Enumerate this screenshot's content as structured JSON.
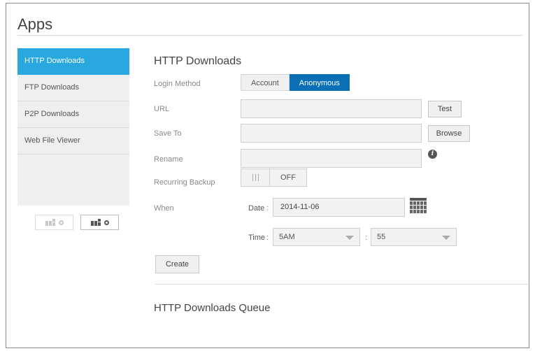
{
  "page": {
    "title": "Apps"
  },
  "sidebar": {
    "items": [
      {
        "label": "HTTP Downloads",
        "active": true
      },
      {
        "label": "FTP Downloads",
        "active": false
      },
      {
        "label": "P2P Downloads",
        "active": false
      },
      {
        "label": "Web File Viewer",
        "active": false
      }
    ],
    "buttons": [
      {
        "icon": "remove-app-icon",
        "enabled": false
      },
      {
        "icon": "add-app-icon",
        "enabled": true
      }
    ]
  },
  "form": {
    "title": "HTTP Downloads",
    "login_method": {
      "label": "Login Method",
      "options": [
        "Account",
        "Anonymous"
      ],
      "selected": "Anonymous"
    },
    "url": {
      "label": "URL",
      "value": "",
      "button": "Test"
    },
    "save_to": {
      "label": "Save To",
      "value": "",
      "button": "Browse"
    },
    "rename": {
      "label": "Rename",
      "value": "",
      "info_icon": "info-icon"
    },
    "recurring_backup": {
      "label": "Recurring Backup",
      "state": "OFF"
    },
    "when": {
      "label": "When",
      "date_label": "Date",
      "date_value": "2014-11-06",
      "time_label": "Time",
      "hour": "5AM",
      "minute": "55",
      "calendar_icon": "calendar-icon"
    },
    "create_button": "Create"
  },
  "queue": {
    "title": "HTTP Downloads Queue"
  },
  "colors": {
    "accent": "#29a8e0",
    "selected": "#0b6fb8"
  }
}
